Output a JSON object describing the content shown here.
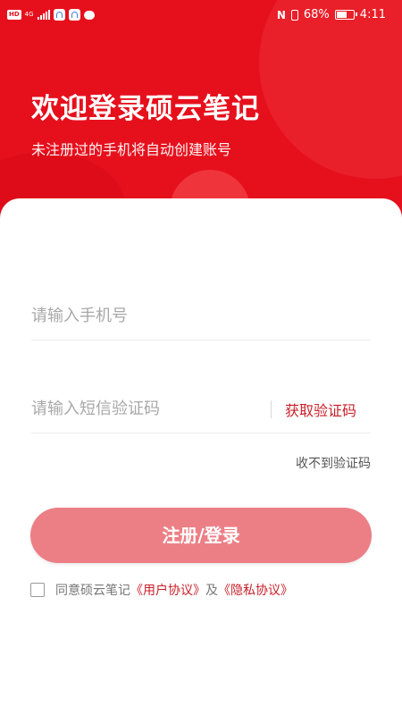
{
  "status_bar": {
    "hd": "HD",
    "network": "4G",
    "nfc": "N",
    "battery_percent": "68%",
    "battery_level": 0.68,
    "time": "4:11"
  },
  "header": {
    "title": "欢迎登录硕云笔记",
    "subtitle": "未注册过的手机将自动创建账号"
  },
  "form": {
    "phone_placeholder": "请输入手机号",
    "code_placeholder": "请输入短信验证码",
    "get_code_label": "获取验证码",
    "no_code_label": "收不到验证码",
    "submit_label": "注册/登录"
  },
  "agreement": {
    "prefix": "同意硕云笔记",
    "user_agreement": "《用户协议》",
    "conjunction": "及",
    "privacy_agreement": "《隐私协议》"
  },
  "colors": {
    "brand_red": "#e6101d",
    "button_disabled": "#ec7f86",
    "link": "#c8202a"
  }
}
